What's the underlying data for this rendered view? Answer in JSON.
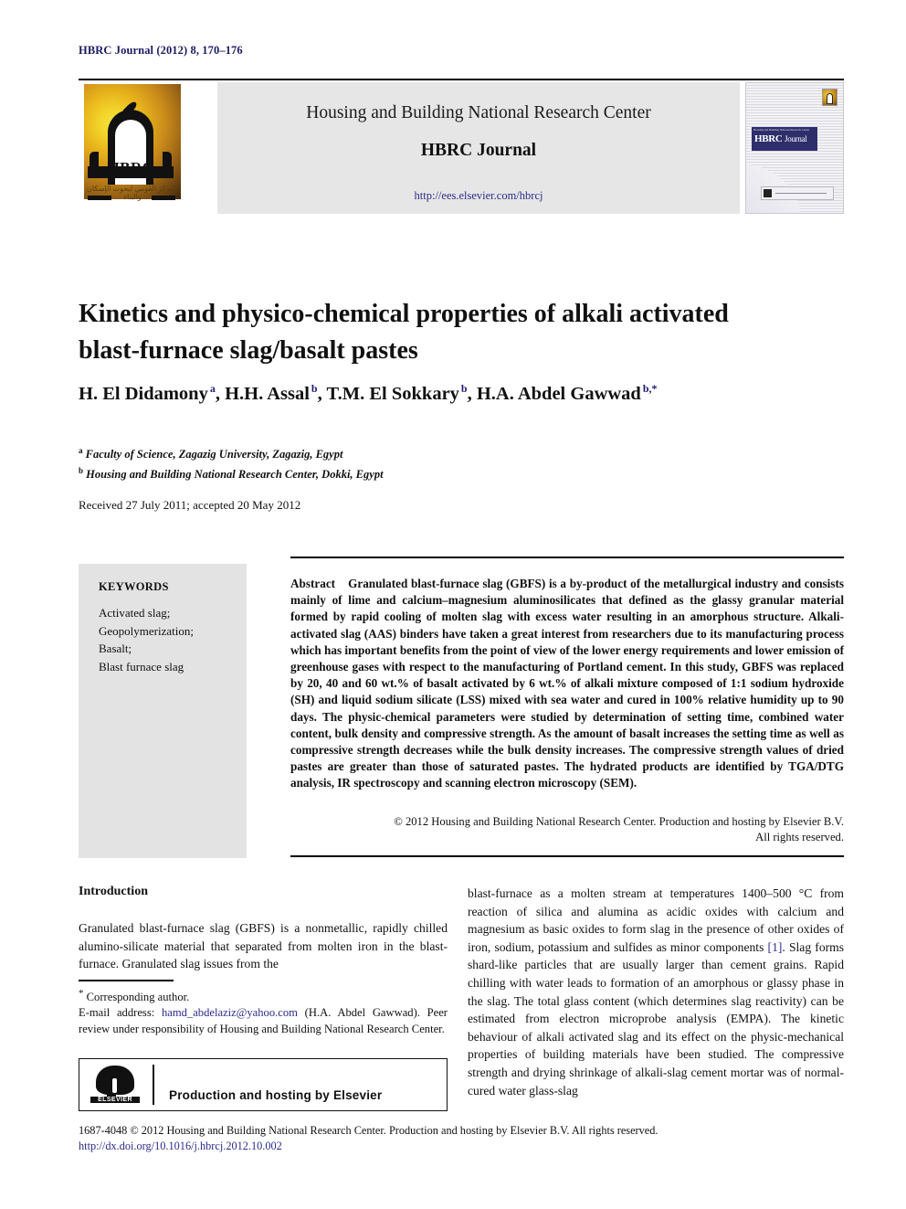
{
  "running_head": "HBRC Journal (2012) 8, 170–176",
  "masthead": {
    "center_title": "Housing and Building National Research Center",
    "journal_name": "HBRC Journal",
    "url": "http://ees.elsevier.com/hbrcj",
    "logo": {
      "acronym": "HBRC",
      "arabic_caption": "المركز القومي لبحوث الإسكان والبناء"
    },
    "cover": {
      "band_small_text": "Housing and Building National Research Center",
      "band_main": "HBRC",
      "band_sub": "Journal"
    }
  },
  "article": {
    "title": "Kinetics and physico-chemical properties of alkali activated blast-furnace slag/basalt pastes",
    "authors": [
      {
        "name": "H. El Didamony",
        "sup": "a"
      },
      {
        "name": "H.H. Assal",
        "sup": "b"
      },
      {
        "name": "T.M. El Sokkary",
        "sup": "b"
      },
      {
        "name": "H.A. Abdel Gawwad",
        "sup": "b,*"
      }
    ],
    "affiliations": [
      {
        "marker": "a",
        "text": "Faculty of Science, Zagazig University, Zagazig, Egypt"
      },
      {
        "marker": "b",
        "text": "Housing and Building National Research Center, Dokki, Egypt"
      }
    ],
    "received": "Received 27 July 2011; accepted 20 May 2012"
  },
  "keywords": {
    "heading": "KEYWORDS",
    "items": [
      "Activated slag;",
      "Geopolymerization;",
      "Basalt;",
      "Blast furnace slag"
    ]
  },
  "abstract": {
    "label": "Abstract",
    "text": "Granulated blast-furnace slag (GBFS) is a by-product of the metallurgical industry and consists mainly of lime and calcium–magnesium aluminosilicates that defined as the glassy granular material formed by rapid cooling of molten slag with excess water resulting in an amorphous structure. Alkali-activated slag (AAS) binders have taken a great interest from researchers due to its manufacturing process which has important benefits from the point of view of the lower energy requirements and lower emission of greenhouse gases with respect to the manufacturing of Portland cement. In this study, GBFS was replaced by 20, 40 and 60 wt.% of basalt activated by 6 wt.% of alkali mixture composed of 1:1 sodium hydroxide (SH) and liquid sodium silicate (LSS) mixed with sea water and cured in 100% relative humidity up to 90 days. The physic-chemical parameters were studied by determination of setting time, combined water content, bulk density and compressive strength. As the amount of basalt increases the setting time as well as compressive strength decreases while the bulk density increases. The compressive strength values of dried pastes are greater than those of saturated pastes. The hydrated products are identified by TGA/DTG analysis, IR spectroscopy and scanning electron microscopy (SEM).",
    "copyright_line1": "© 2012 Housing and Building National Research Center. Production and hosting by Elsevier B.V.",
    "copyright_line2": "All rights reserved."
  },
  "body": {
    "intro_heading": "Introduction",
    "left_paragraph": "Granulated blast-furnace slag (GBFS) is a nonmetallic, rapidly chilled alumino-silicate material that separated from molten iron in the blast-furnace. Granulated slag issues from the",
    "right_paragraph_part1": "blast-furnace as a molten stream at temperatures 1400–500 °C from reaction of silica and alumina as acidic oxides with calcium and magnesium as basic oxides to form slag in the presence of other oxides of iron, sodium, potassium and sulfides as minor components ",
    "right_citation": "[1]",
    "right_paragraph_part2": ". Slag forms shard-like particles that are usually larger than cement grains. Rapid chilling with water leads to formation of an amorphous or glassy phase in the slag. The total glass content (which determines slag reactivity) can be estimated from electron microprobe analysis (EMPA). The kinetic behaviour of alkali activated slag and its effect on the physic-mechanical properties of building materials have been studied. The compressive strength and drying shrinkage of alkali-slag cement mortar was of normal-cured water glass-slag"
  },
  "footnote": {
    "corresponding_marker": "*",
    "corresponding_text": "Corresponding author.",
    "email_label": "E-mail address:",
    "email": "hamd_abdelaziz@yahoo.com",
    "email_owner": "(H.A. Abdel Gawwad).",
    "peer_review": "Peer review under responsibility of Housing and Building National Research Center."
  },
  "production_box": {
    "logo_word": "ELSEVIER",
    "text": "Production and hosting by Elsevier"
  },
  "page_footer": {
    "line1": "1687-4048 © 2012 Housing and Building National Research Center. Production and hosting by Elsevier B.V. All rights reserved.",
    "line2": "http://dx.doi.org/10.1016/j.hbrcj.2012.10.002"
  },
  "colors": {
    "navy": "#1b1b63",
    "link_blue": "#2b2b8c",
    "keyword_bg": "#e3e3e3",
    "masthead_bg": "#e6e6e6"
  }
}
